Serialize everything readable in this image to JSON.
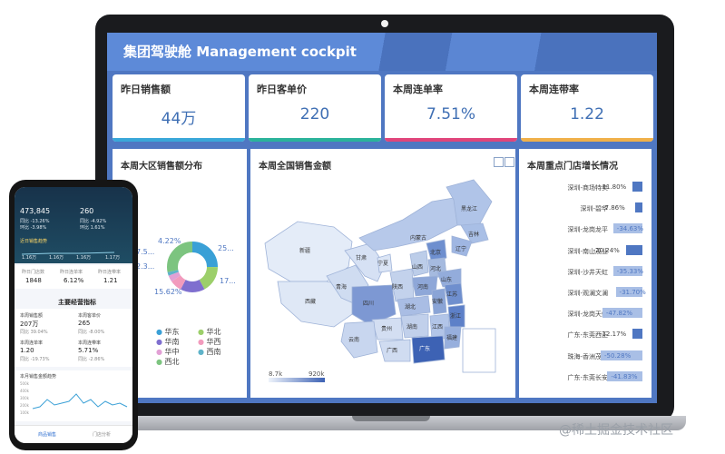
{
  "dashboard": {
    "title": "集团驾驶舱 Management cockpit",
    "kpis": [
      {
        "label": "昨日销售额",
        "value": "44万",
        "color": "#3aa7d9"
      },
      {
        "label": "昨日客单价",
        "value": "220",
        "color": "#2bb39b"
      },
      {
        "label": "本周连单率",
        "value": "7.51%",
        "color": "#e0457b"
      },
      {
        "label": "本周连带率",
        "value": "1.22",
        "color": "#f0b04a"
      }
    ],
    "region_panel": {
      "title": "本周大区销售额分布",
      "labels": [
        "4.22%",
        "25...",
        "15.62%",
        "17...",
        "7.5...",
        "2.3..."
      ],
      "legend": [
        {
          "name": "华东",
          "color": "#3aa0d6"
        },
        {
          "name": "华北",
          "color": "#9ccf6a"
        },
        {
          "name": "华南",
          "color": "#7f6fcf"
        },
        {
          "name": "华西",
          "color": "#f29bbd"
        },
        {
          "name": "华中",
          "color": "#e2a0d5"
        },
        {
          "name": "西南",
          "color": "#5fb3c9"
        },
        {
          "name": "西北",
          "color": "#7cc47f"
        }
      ]
    },
    "map_panel": {
      "title": "本周全国销售金额",
      "provinces": [
        "新疆",
        "西藏",
        "青海",
        "甘肃",
        "内蒙古",
        "黑龙江",
        "吉林",
        "辽宁",
        "北京",
        "山西",
        "河北",
        "山东",
        "河南",
        "陕西",
        "宁夏",
        "四川",
        "湖北",
        "安徽",
        "江苏",
        "浙江",
        "湖南",
        "江西",
        "贵州",
        "云南",
        "广西",
        "广东",
        "福建"
      ],
      "range_min": "8.7k",
      "range_max": "920k"
    },
    "store_panel": {
      "title": "本周重点门店增长情况",
      "stores": [
        {
          "name": "深圳-商场特卖",
          "value": "-11.80%",
          "ratio": 0.12
        },
        {
          "name": "深圳-碧华",
          "value": "-7.86%",
          "ratio": 0.08
        },
        {
          "name": "深圳-龙岗龙平",
          "value": "-34.63%",
          "ratio": 0.35
        },
        {
          "name": "深圳-南山茂业",
          "value": "-20.24%",
          "ratio": 0.2
        },
        {
          "name": "深圳-沙井天虹",
          "value": "-35.33%",
          "ratio": 0.35
        },
        {
          "name": "深圳-观澜文澜",
          "value": "-31.70%",
          "ratio": 0.32
        },
        {
          "name": "深圳-龙岗天虹",
          "value": "-47.82%",
          "ratio": 0.48
        },
        {
          "name": "广东-东莞西正",
          "value": "-12.17%",
          "ratio": 0.12
        },
        {
          "name": "珠海-香洲茂业",
          "value": "-50.28%",
          "ratio": 0.5
        },
        {
          "name": "广东-东莞长安",
          "value": "-41.83%",
          "ratio": 0.42
        }
      ]
    }
  },
  "phone": {
    "stat1": "473,845",
    "stat1_sub1": "同比 -13.26%",
    "stat1_sub2": "环比 -3.98%",
    "stat2": "260",
    "stat2_sub1": "同比 -4.92%",
    "stat2_sub2": "环比 1.61%",
    "trend_title": "近日销售趋势",
    "trend_values": [
      "1.16万",
      "1.16万",
      "1.16万",
      "1.17万"
    ],
    "mini_stats": [
      {
        "label": "昨日门店数",
        "value": "1848"
      },
      {
        "label": "昨日连单率",
        "value": "6.12%"
      },
      {
        "label": "昨日连带率",
        "value": "1.21"
      }
    ],
    "section_title": "主要经营指标",
    "metrics": [
      {
        "label": "本周销售额",
        "value": "207万",
        "sub": "同比 39.04%"
      },
      {
        "label": "本周客单价",
        "value": "265",
        "sub": "同比 -8.00%"
      },
      {
        "label": "本周连单率",
        "value": "1.20",
        "sub": "同比 -19.73%"
      },
      {
        "label": "本周连带率",
        "value": "5.71%",
        "sub": "同比 -2.86%"
      }
    ],
    "chart_title": "本月销售金额趋势",
    "y_ticks": [
      "500k",
      "400k",
      "300k",
      "200k",
      "100k"
    ],
    "tabs": [
      "商品销售",
      "门店分析"
    ]
  },
  "watermark": "@稀土掘金技术社区"
}
